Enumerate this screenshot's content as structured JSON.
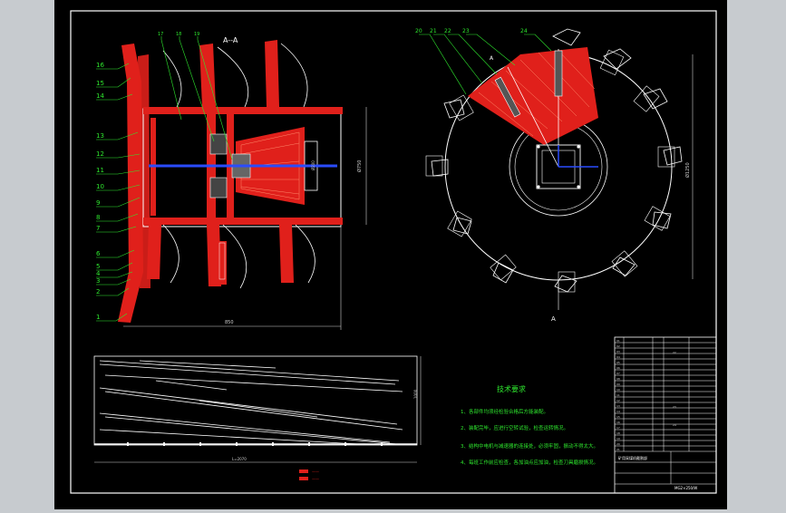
{
  "labels": {
    "left_numbers": [
      "16",
      "15",
      "14",
      "13",
      "12",
      "11",
      "10",
      "9",
      "8",
      "7",
      "6",
      "5",
      "4",
      "3",
      "2",
      "1"
    ],
    "top_section": [
      "17",
      "18",
      "19"
    ],
    "right_numbers": [
      "20",
      "21",
      "22",
      "23",
      "24"
    ],
    "section_title": "A--A",
    "mark_a_top": "A",
    "mark_a_bottom": "A",
    "dim_bottom": "850",
    "dim_height": "Ø750",
    "dim_bore": "Ø200",
    "dim_disc": "Ø1250",
    "dim_conveyor_len": "L=2070",
    "dim_conveyor_h": "1000"
  },
  "notes": {
    "title": "技术要求",
    "items": [
      "1、各部件均须经检验合格后方能装配。",
      "2、装配完毕，应进行空转试验，检查运转情况。",
      "3、结构中电机与减速器的连接处，必须牢固，振动不得太大。",
      "4、每班工作前应检查，各加油点应加油，检查刀具磨损情况。"
    ]
  },
  "legend": {
    "line1": "——",
    "line2": "——"
  },
  "title_block": {
    "drawing_title": "矿用采煤机截割部",
    "drawing_code": "MG2×250/W",
    "row_codes": [
      "01",
      "02",
      "03",
      "04",
      "05",
      "06",
      "07",
      "08",
      "09",
      "10",
      "11",
      "12",
      "13",
      "14",
      "15",
      "16",
      "17",
      "18",
      "19",
      "20",
      "21",
      "22",
      "23",
      "24"
    ]
  },
  "colors": {
    "sheet": "#000000",
    "frame": "#ffffff",
    "section_fill": "#e0201b",
    "hatch": "#ff5a3c",
    "leader": "#2ee82e",
    "center": "#2a4cff",
    "dim": "#d0d0d0"
  }
}
